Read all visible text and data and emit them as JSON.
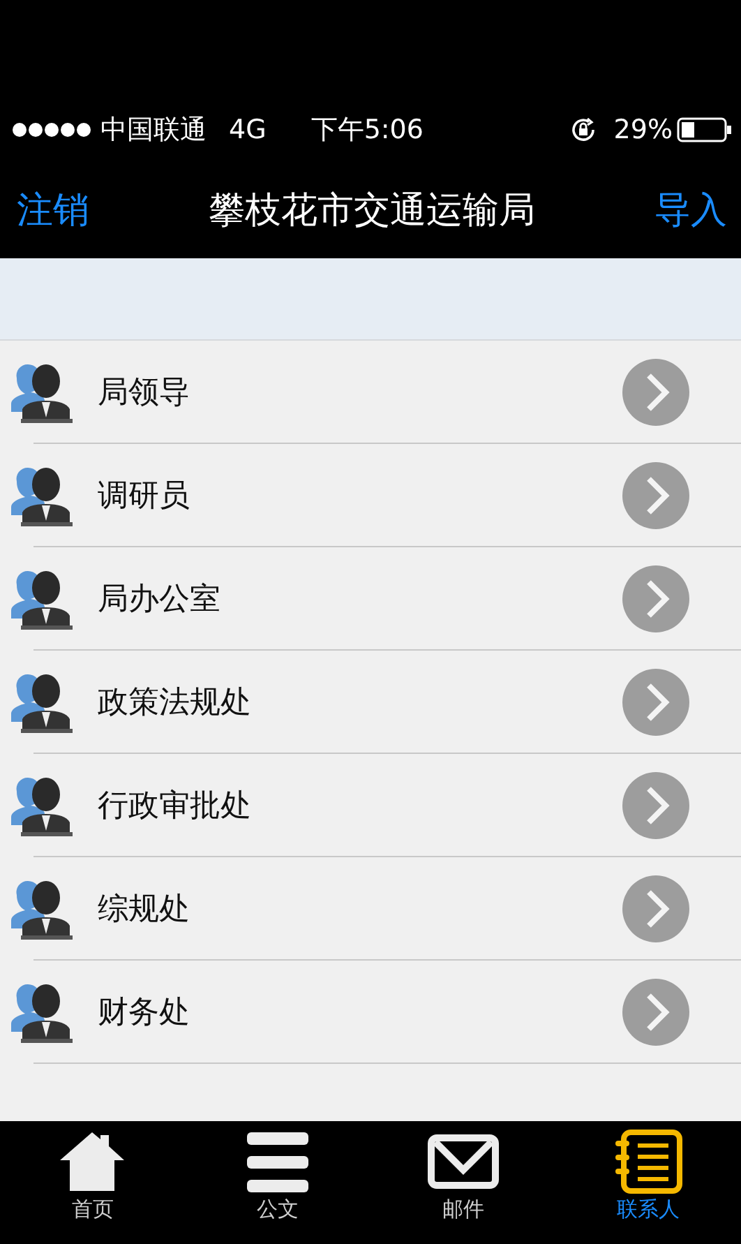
{
  "status_bar": {
    "carrier": "中国联通",
    "network": "4G",
    "time": "下午5:06",
    "battery": "29%"
  },
  "nav_bar": {
    "left_button": "注销",
    "title": "攀枝花市交通运输局",
    "right_button": "导入"
  },
  "contacts": [
    {
      "name": "局领导"
    },
    {
      "name": "调研员"
    },
    {
      "name": "局办公室"
    },
    {
      "name": "政策法规处"
    },
    {
      "name": "行政审批处"
    },
    {
      "name": "综规处"
    },
    {
      "name": "财务处"
    }
  ],
  "tab_bar": [
    {
      "label": "首页",
      "kind": "home",
      "selected": false
    },
    {
      "label": "公文",
      "kind": "documents",
      "selected": false
    },
    {
      "label": "邮件",
      "kind": "mail",
      "selected": false
    },
    {
      "label": "联系人",
      "kind": "contacts",
      "selected": true
    }
  ]
}
